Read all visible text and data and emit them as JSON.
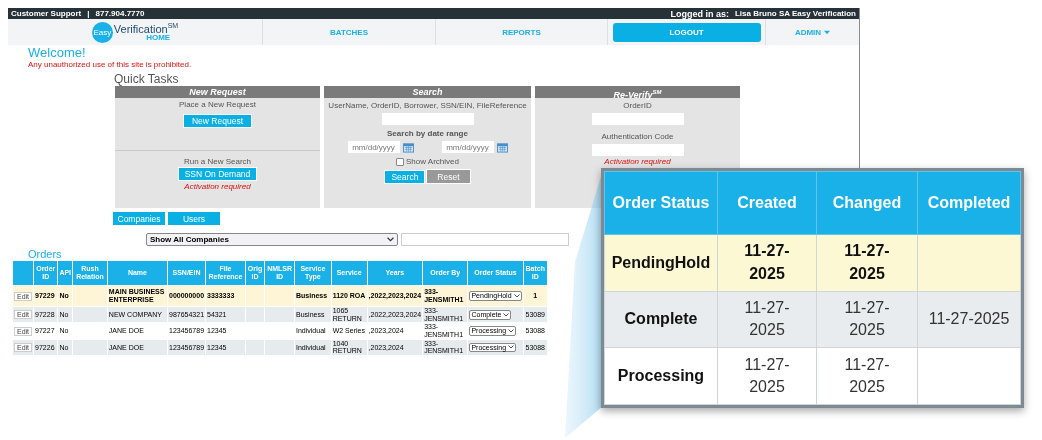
{
  "top_bar": {
    "support_label": "Customer Support",
    "separator": "|",
    "phone": "877.904.7770",
    "logged_in_label": "Logged in as:",
    "user": "Lisa Bruno SA Easy Verification"
  },
  "nav": {
    "logo": {
      "badge": "Easy",
      "name": "Verification$^{SM}$",
      "subtitle": "HOME"
    },
    "items": [
      {
        "label": "BATCHES",
        "kind": "link"
      },
      {
        "label": "REPORTS",
        "kind": "link"
      },
      {
        "label": "LOGOUT",
        "kind": "button"
      },
      {
        "label": "ADMIN",
        "kind": "menu"
      }
    ]
  },
  "welcome": {
    "title": "Welcome!",
    "notice": "Any unauthorized use of this site is prohibited."
  },
  "quick_tasks": {
    "title": "Quick Tasks",
    "new_request": {
      "title": "New Request",
      "sections": [
        {
          "caption": "Place a New Request",
          "button": "New Request"
        },
        {
          "caption": "Run a New Search",
          "button": "SSN On Demand",
          "note": "Activation required"
        }
      ]
    },
    "search": {
      "title": "Search",
      "hint": "UserName, OrderID, Borrower, SSN/EIN, FileReference",
      "date_label": "Search by date range",
      "date_from_placeholder": "mm/dd/yyyy",
      "date_to_placeholder": "mm/dd/yyyy",
      "show_archived": {
        "label": "Show Archived",
        "checked": false
      },
      "buttons": [
        "Search",
        "Reset"
      ]
    },
    "re_verify": {
      "title": "Re-Verify$^{SM}$",
      "order_label": "OrderID",
      "auth_label": "Authentication Code",
      "note": "Activation required"
    }
  },
  "buttons": [
    "Companies",
    "Users"
  ],
  "company_filter": {
    "value": "Show All Companies"
  },
  "orders": {
    "title": "Orders",
    "columns": [
      "Order ID",
      "API",
      "Rush Relation",
      "Name",
      "SSN/EIN",
      "File Reference",
      "Orig ID",
      "NMLSR ID",
      "Service Type",
      "Service",
      "Years",
      "Order By",
      "Order Status",
      "Batch ID"
    ],
    "rows": [
      {
        "highlighted": true,
        "action": "Edit",
        "order_id": "97229",
        "api": "No",
        "name": "MAIN BUSINESS ENTERPRISE",
        "ssn": "000000000",
        "file_reference": "3333333",
        "service_type": "Business",
        "service": "1120 ROA",
        "years": ",2022,2023,2024",
        "order_by": "333-JENSMITH1",
        "status": "PendingHold",
        "batch_id": "1"
      },
      {
        "highlighted": false,
        "action": "Edit",
        "order_id": "97228",
        "api": "No",
        "name": "NEW COMPANY",
        "ssn": "987654321",
        "file_reference": "54321",
        "service_type": "Business",
        "service": "1065 RETURN",
        "years": ",2022,2023,2024",
        "order_by": "333-JENSMITH1",
        "status": "Complete",
        "batch_id": "53089"
      },
      {
        "highlighted": false,
        "action": "Edit",
        "order_id": "97227",
        "api": "No",
        "name": "JANE DOE",
        "ssn": "123456789",
        "file_reference": "12345",
        "service_type": "Individual",
        "service": "W2 Series",
        "years": ",2023,2024",
        "order_by": "333-JENSMITH1",
        "status": "Processing",
        "batch_id": "53088"
      },
      {
        "highlighted": false,
        "action": "Edit",
        "order_id": "97226",
        "api": "No",
        "name": "JANE DOE",
        "ssn": "123456789",
        "file_reference": "12345",
        "service_type": "Individual",
        "service": "1040 RETURN",
        "years": ",2023,2024",
        "order_by": "333-JENSMITH1",
        "status": "Processing",
        "batch_id": "53088"
      }
    ]
  },
  "zoom_callout": {
    "columns": [
      "Order Status",
      "Created",
      "Changed",
      "Completed"
    ],
    "rows": [
      {
        "highlighted": true,
        "status": "PendingHold",
        "created": "11-27-2025",
        "changed": "11-27-2025"
      },
      {
        "highlighted": false,
        "status": "Complete",
        "created": "11-27-2025",
        "changed": "11-27-2025",
        "completed": "11-27-2025"
      },
      {
        "highlighted": false,
        "status": "Processing",
        "created": "11-27-2025",
        "changed": "11-27-2025"
      }
    ]
  }
}
